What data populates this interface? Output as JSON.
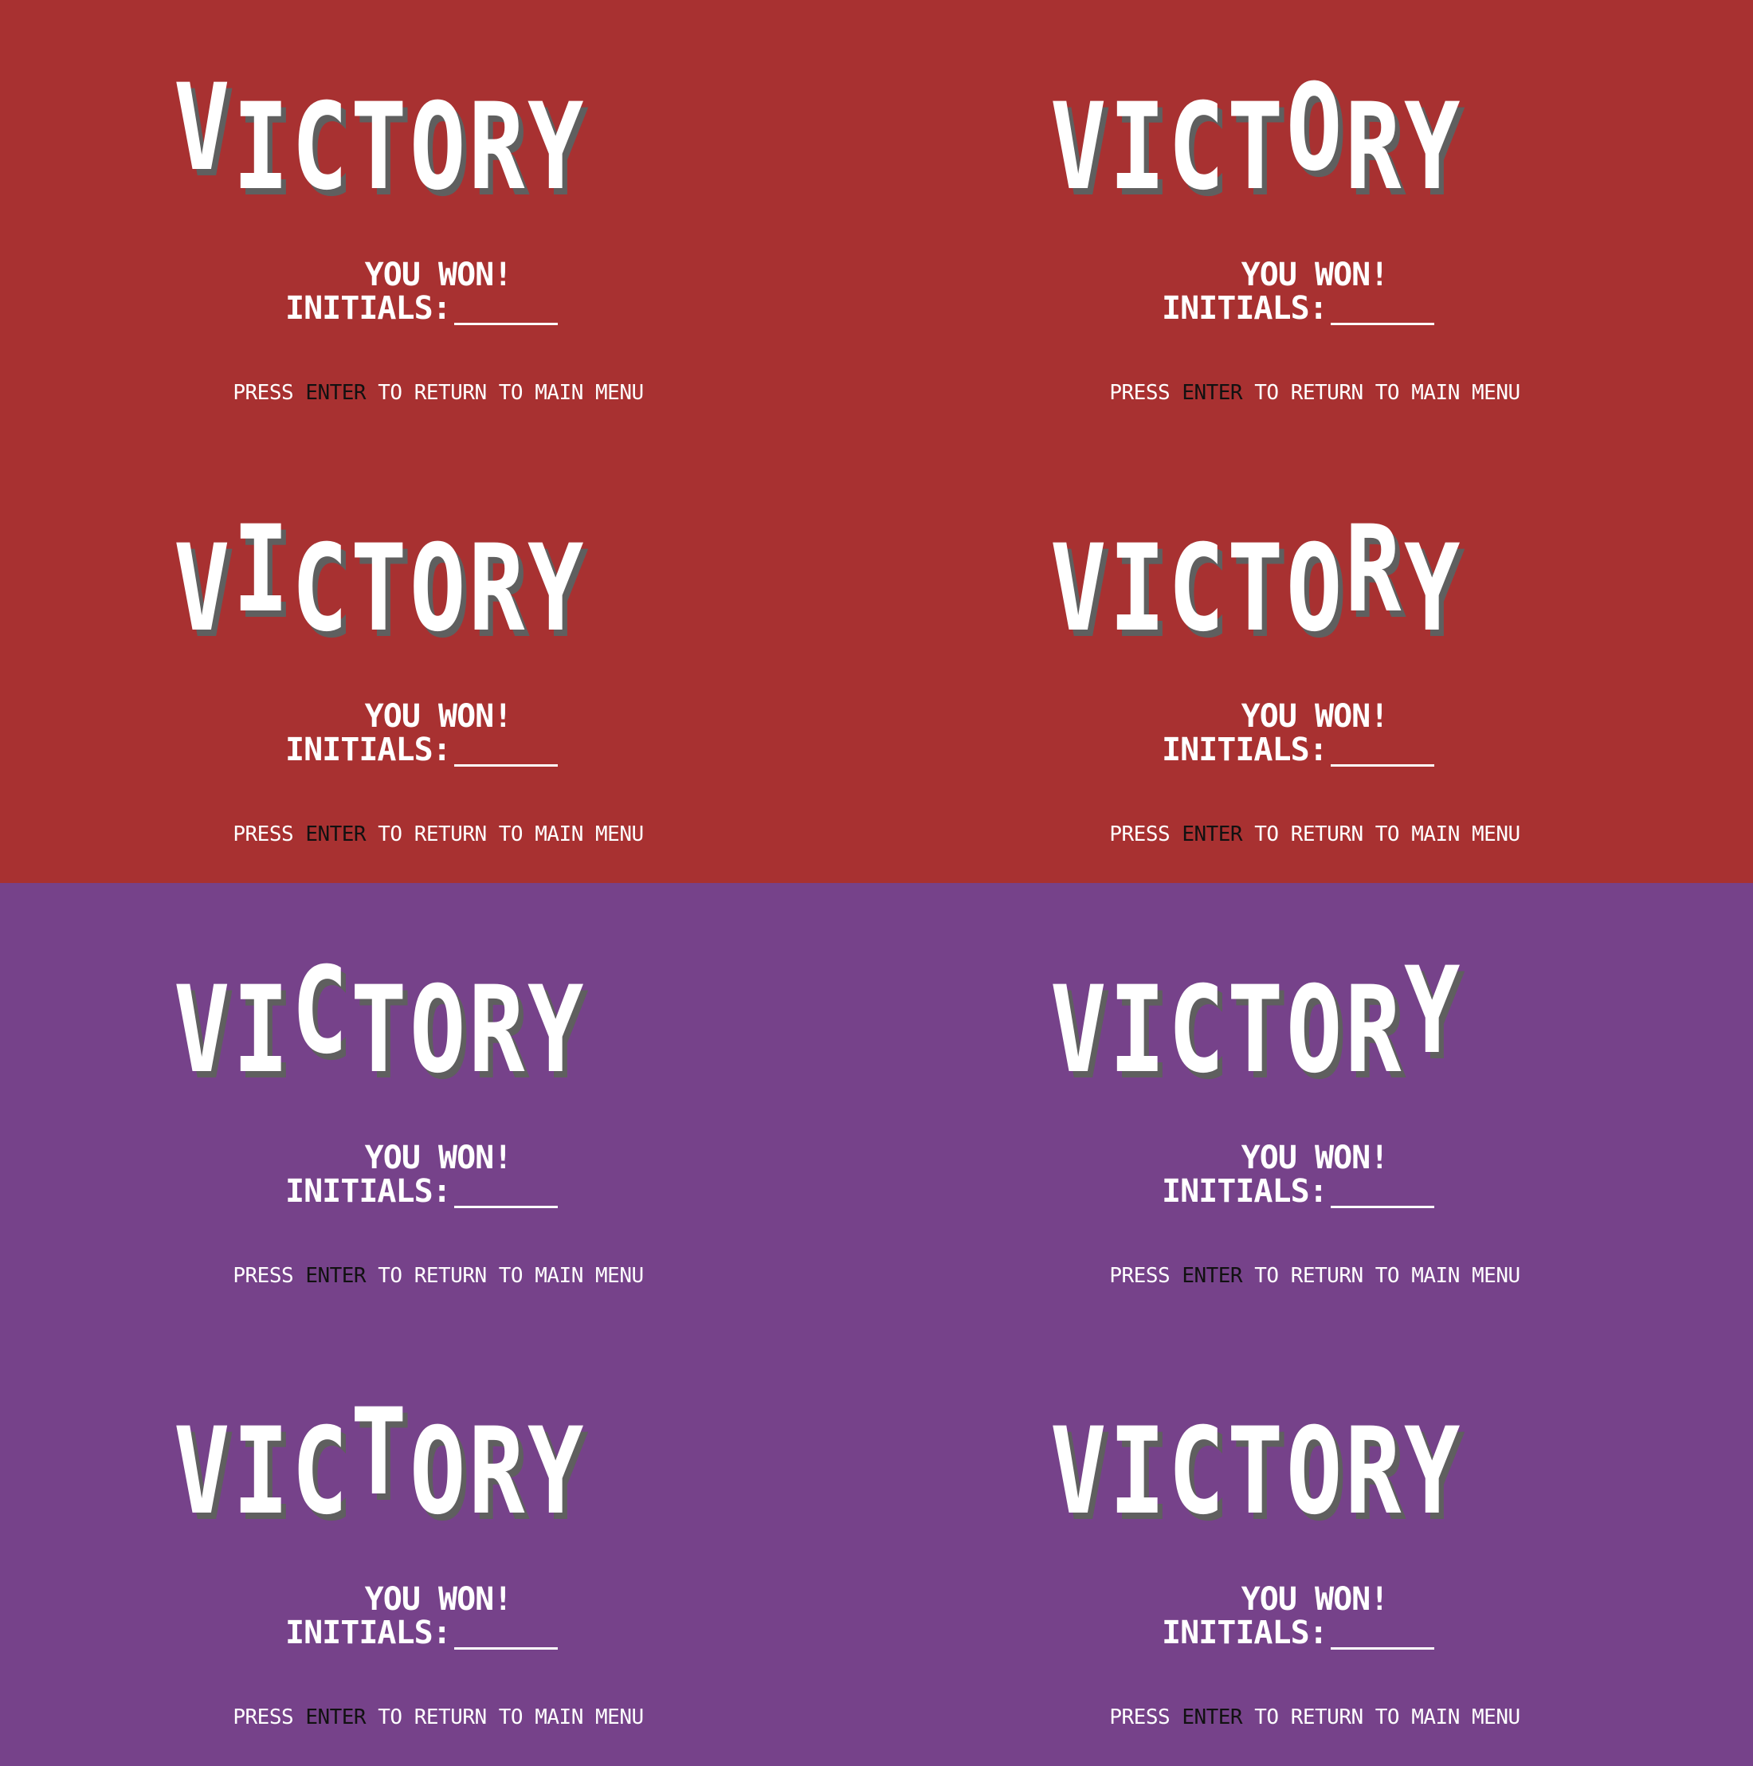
{
  "screen": {
    "title_letters": [
      "V",
      "I",
      "C",
      "T",
      "O",
      "R",
      "Y"
    ],
    "you_won": "YOU WON!",
    "initials_label": "INITIALS:",
    "prompt_before": "PRESS",
    "prompt_key": "ENTER",
    "prompt_after": "TO RETURN TO MAIN MENU"
  },
  "colors": {
    "red_background": "#a83131",
    "purple_background": "#76428a",
    "text": "#ffffff",
    "shadow": "#5f5f5f",
    "key_text": "#111111"
  },
  "frames": [
    {
      "theme": "red",
      "raised_letter": 0
    },
    {
      "theme": "red",
      "raised_letter": 4
    },
    {
      "theme": "red",
      "raised_letter": 1
    },
    {
      "theme": "red",
      "raised_letter": 5
    },
    {
      "theme": "purple",
      "raised_letter": 2
    },
    {
      "theme": "purple",
      "raised_letter": 6
    },
    {
      "theme": "purple",
      "raised_letter": 3
    },
    {
      "theme": "purple",
      "raised_letter": null
    }
  ]
}
